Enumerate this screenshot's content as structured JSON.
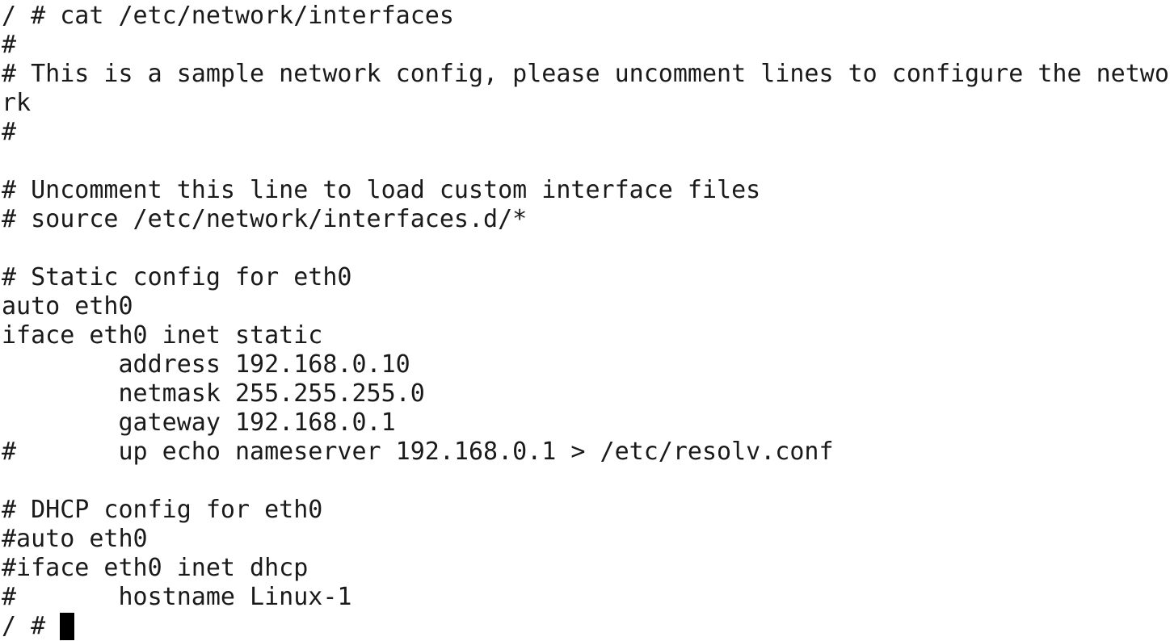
{
  "terminal": {
    "lines": [
      "/ # cat /etc/network/interfaces",
      "#",
      "# This is a sample network config, please uncomment lines to configure the netwo",
      "rk",
      "#",
      "",
      "# Uncomment this line to load custom interface files",
      "# source /etc/network/interfaces.d/*",
      "",
      "# Static config for eth0",
      "auto eth0",
      "iface eth0 inet static",
      "        address 192.168.0.10",
      "        netmask 255.255.255.0",
      "        gateway 192.168.0.1",
      "#       up echo nameserver 192.168.0.1 > /etc/resolv.conf",
      "",
      "# DHCP config for eth0",
      "#auto eth0",
      "#iface eth0 inet dhcp",
      "#       hostname Linux-1"
    ],
    "prompt": "/ # "
  }
}
